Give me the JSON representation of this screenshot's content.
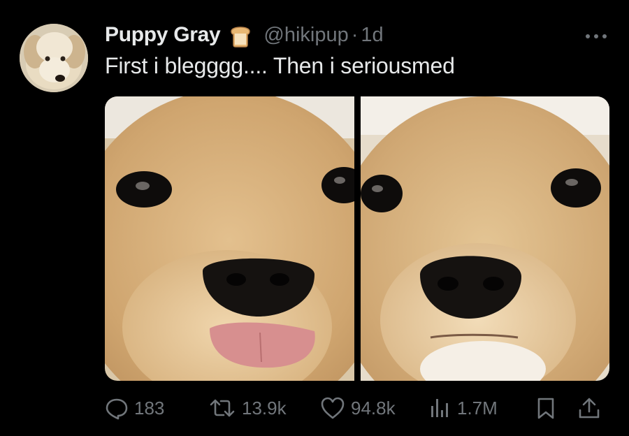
{
  "author": {
    "display_name": "Puppy Gray",
    "badge_icon": "bread-icon",
    "handle": "@hikipup",
    "separator": "·",
    "time": "1d"
  },
  "tweet": {
    "text": "First i blegggg.... Then i seriousmed"
  },
  "actions": {
    "replies": "183",
    "retweets": "13.9k",
    "likes": "94.8k",
    "views": "1.7M"
  },
  "colors": {
    "background": "#000000",
    "text": "#e7e9ea",
    "muted": "#71767b"
  }
}
